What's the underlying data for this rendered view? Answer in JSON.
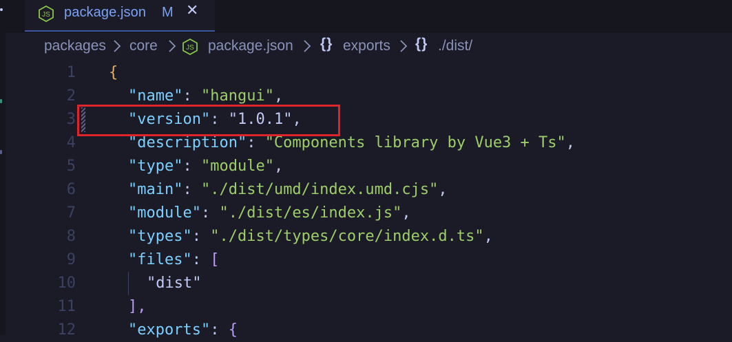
{
  "tab": {
    "title": "package.json",
    "modified_indicator": "M",
    "close_glyph": "✕",
    "icon": "nodejs-icon"
  },
  "breadcrumb": {
    "items": [
      "packages",
      "core",
      "package.json",
      "exports",
      "./dist/"
    ],
    "file_icon": "nodejs-icon",
    "object_icon": "braces-icon",
    "separator": ">"
  },
  "editor": {
    "line_numbers": [
      "1",
      "2",
      "3",
      "4",
      "5",
      "6",
      "7",
      "8",
      "9",
      "10",
      "11",
      "12"
    ],
    "lines": [
      {
        "text": "{"
      },
      {
        "key": "\"name\"",
        "sep": ": ",
        "value": "\"hangui\"",
        "tail": ","
      },
      {
        "key": "\"version\"",
        "sep": ": ",
        "value": "\"1.0.1\"",
        "tail": ","
      },
      {
        "key": "\"description\"",
        "sep": ": ",
        "value": "\"Components library by Vue3 + Ts\"",
        "tail": ","
      },
      {
        "key": "\"type\"",
        "sep": ": ",
        "value": "\"module\"",
        "tail": ","
      },
      {
        "key": "\"main\"",
        "sep": ": ",
        "value": "\"./dist/umd/index.umd.cjs\"",
        "tail": ","
      },
      {
        "key": "\"module\"",
        "sep": ": ",
        "value": "\"./dist/es/index.js\"",
        "tail": ","
      },
      {
        "key": "\"types\"",
        "sep": ": ",
        "value": "\"./dist/types/core/index.d.ts\"",
        "tail": ","
      },
      {
        "key": "\"files\"",
        "sep": ": ",
        "value": "[",
        "tail": ""
      },
      {
        "value": "\"dist\""
      },
      {
        "text": "],"
      },
      {
        "key": "\"exports\"",
        "sep": ": ",
        "value": "{",
        "tail": ""
      }
    ]
  },
  "colors": {
    "background": "#1a1b26",
    "key": "#7dcfff",
    "string": "#9ece6a",
    "highlight_box": "#e0242b",
    "tab_title": "#7aa2f7"
  }
}
